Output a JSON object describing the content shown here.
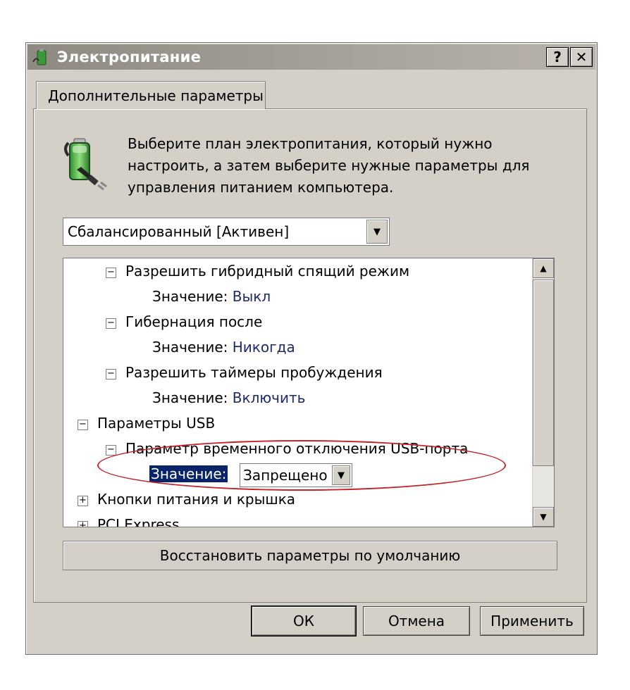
{
  "window": {
    "title": "Электропитание",
    "help_button": "?",
    "close_button": "✕"
  },
  "tab": {
    "label": "Дополнительные параметры"
  },
  "description": "Выберите план электропитания, который нужно настроить, а затем выберите нужные параметры для управления питанием компьютера.",
  "plan_select": {
    "value": "Сбалансированный [Активен]"
  },
  "tree": {
    "items": [
      {
        "toggle": "−",
        "label": "Разрешить гибридный спящий режим"
      },
      {
        "value_label": "Значение:",
        "value": "Выкл"
      },
      {
        "toggle": "−",
        "label": "Гибернация после"
      },
      {
        "value_label": "Значение:",
        "value": "Никогда"
      },
      {
        "toggle": "−",
        "label": "Разрешить таймеры пробуждения"
      },
      {
        "value_label": "Значение:",
        "value": "Включить"
      },
      {
        "toggle": "−",
        "label": "Параметры USB"
      },
      {
        "toggle": "−",
        "label": "Параметр временного отключения USB-порта"
      },
      {
        "value_label": "Значение:",
        "value": "Запрещено"
      },
      {
        "toggle": "+",
        "label": "Кнопки питания и крышка"
      },
      {
        "toggle": "+",
        "label": "PCI Express"
      }
    ]
  },
  "buttons": {
    "restore": "Восстановить параметры по умолчанию",
    "ok": "ОК",
    "cancel": "Отмена",
    "apply": "Применить"
  },
  "colors": {
    "dialog_bg": "#d4d0c8",
    "selection": "#0a246a",
    "value_text": "#1f2a6e",
    "highlight_oval": "#c2252b"
  }
}
